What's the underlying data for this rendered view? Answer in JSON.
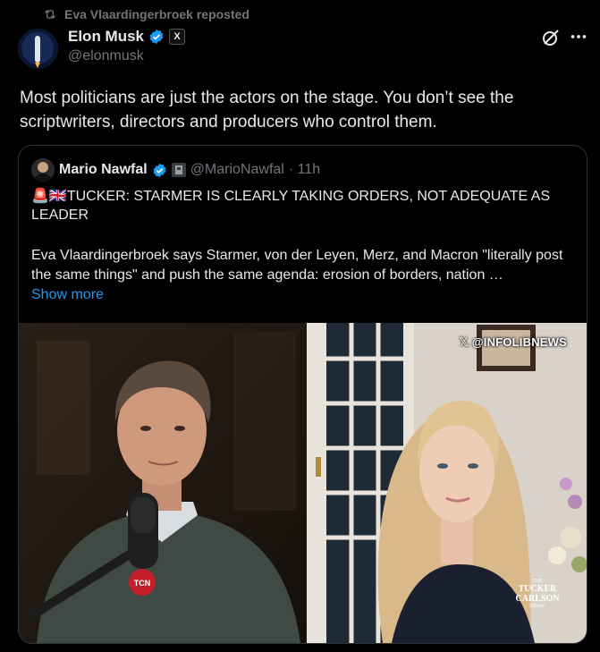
{
  "repost": {
    "text": "Eva Vlaardingerbroek reposted",
    "icon": "repost-icon"
  },
  "author": {
    "name": "Elon Musk",
    "handle": "@elonmusk",
    "verified_color": "#1d9bf0",
    "affiliate_badge": "X"
  },
  "post": {
    "text": "Most politicians are just the actors on the stage. You don’t see the scriptwriters, directors and producers who control them."
  },
  "quote": {
    "name": "Mario Nawfal",
    "handle": "@MarioNawfal",
    "time": "· 11h",
    "headline": "🚨🇬🇧TUCKER: STARMER IS CLEARLY TAKING ORDERS, NOT ADEQUATE AS LEADER",
    "body": "Eva Vlaardingerbroek says Starmer, von der Leyen, Merz, and Macron \"literally post the same things\" and push the same agenda: erosion of borders, nation …",
    "show_more": "Show more"
  },
  "media": {
    "watermark": "𝕏 @INFOLIBNEWS",
    "mic_label": "TCN",
    "logo_top": "THE",
    "logo_line1": "TUCKER",
    "logo_line2": "CARLSON",
    "logo_bottom": "SHOW"
  },
  "colors": {
    "background": "#000000",
    "text": "#e7e9ea",
    "muted": "#71767b",
    "link": "#1d9bf0",
    "border": "#2f3336"
  }
}
